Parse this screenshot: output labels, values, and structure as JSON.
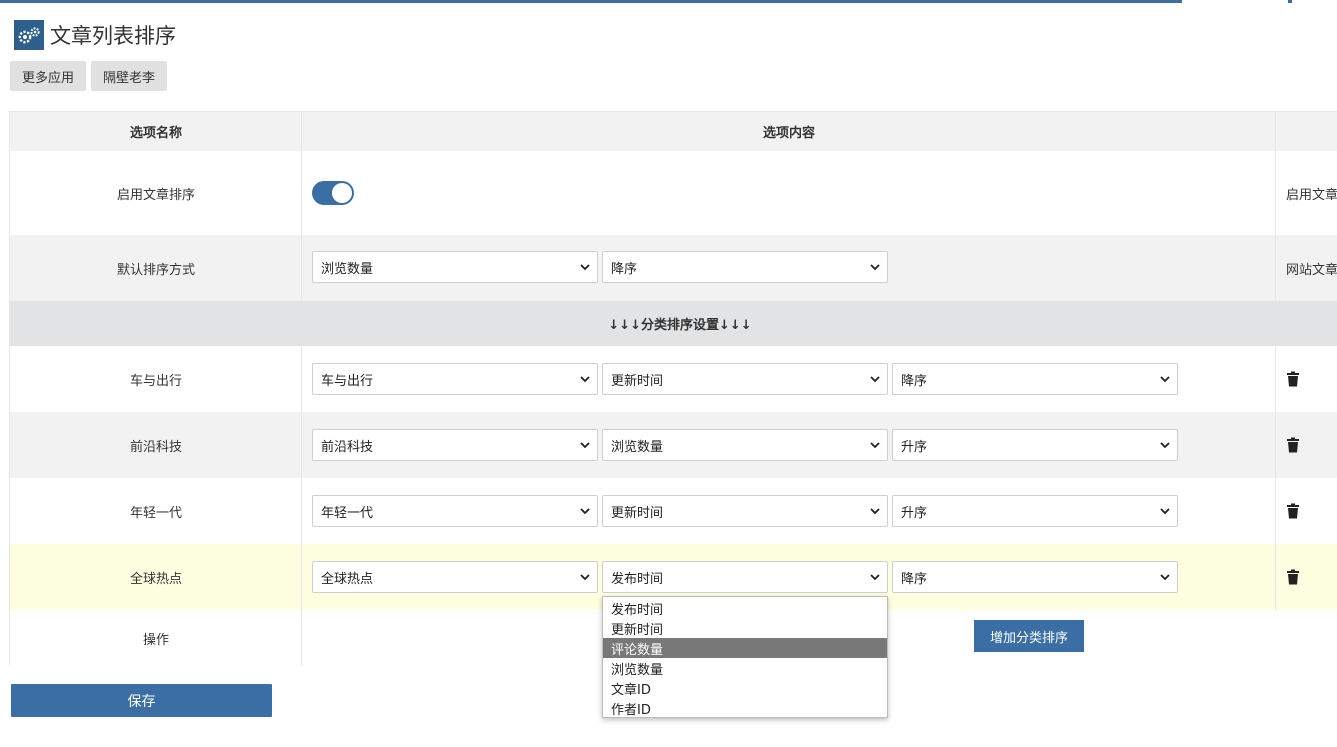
{
  "page": {
    "title": "文章列表排序"
  },
  "header_buttons": [
    {
      "label": "更多应用"
    },
    {
      "label": "隔壁老李"
    }
  ],
  "table": {
    "col_name": "选项名称",
    "col_content": "选项内容",
    "enable_row": {
      "label": "启用文章排序",
      "toggle_on": true,
      "desc": "启用文章"
    },
    "default_row": {
      "label": "默认排序方式",
      "field": "浏览数量",
      "order": "降序",
      "desc": "网站文章"
    },
    "section_title": "↓↓↓分类排序设置↓↓↓",
    "category_rows": [
      {
        "label": "车与出行",
        "category": "车与出行",
        "field": "更新时间",
        "order": "降序"
      },
      {
        "label": "前沿科技",
        "category": "前沿科技",
        "field": "浏览数量",
        "order": "升序"
      },
      {
        "label": "年轻一代",
        "category": "年轻一代",
        "field": "更新时间",
        "order": "升序"
      },
      {
        "label": "全球热点",
        "category": "全球热点",
        "field": "发布时间",
        "order": "降序"
      }
    ],
    "action_row": {
      "label": "操作",
      "add_button": "增加分类排序"
    }
  },
  "save_button": "保存",
  "dropdown": {
    "options": [
      "发布时间",
      "更新时间",
      "评论数量",
      "浏览数量",
      "文章ID",
      "作者ID"
    ],
    "highlighted": "评论数量"
  },
  "colors": {
    "accent": "#3a6ea5",
    "header_bg": "#f2f2f2",
    "section_bg": "#e2e3e5",
    "highlight_row": "#fefee0"
  }
}
